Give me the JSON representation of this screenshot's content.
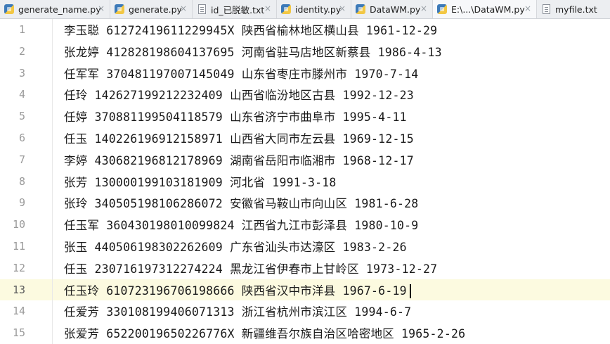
{
  "tabs": [
    {
      "label": "generate_name.py",
      "icon": "python-file-icon",
      "kind": "py",
      "close": "×"
    },
    {
      "label": "generate.py",
      "icon": "python-file-icon",
      "kind": "py",
      "close": "×"
    },
    {
      "label": "id_已脱敏.txt",
      "icon": "text-file-icon",
      "kind": "txt",
      "close": "×"
    },
    {
      "label": "identity.py",
      "icon": "python-file-icon",
      "kind": "py",
      "close": "×"
    },
    {
      "label": "DataWM.py",
      "icon": "python-file-icon",
      "kind": "py",
      "close": "×"
    },
    {
      "label": "E:\\...\\DataWM.py",
      "icon": "python-file-icon",
      "kind": "py",
      "close": "×"
    },
    {
      "label": "myfile.txt",
      "icon": "text-file-icon",
      "kind": "txt",
      "close": ""
    }
  ],
  "active_tab": 5,
  "current_line": 13,
  "lines": [
    {
      "n": "1",
      "text": "李玉聪 61272419611229945X 陕西省榆林地区横山县 1961-12-29"
    },
    {
      "n": "2",
      "text": "张龙婷 412828198604137695 河南省驻马店地区新蔡县 1986-4-13"
    },
    {
      "n": "3",
      "text": "任军军 370481197007145049 山东省枣庄市滕州市 1970-7-14"
    },
    {
      "n": "4",
      "text": "任玲 142627199212232409 山西省临汾地区古县 1992-12-23"
    },
    {
      "n": "5",
      "text": "任婷 370881199504118579 山东省济宁市曲阜市 1995-4-11"
    },
    {
      "n": "6",
      "text": "任玉 140226196912158971 山西省大同市左云县 1969-12-15"
    },
    {
      "n": "7",
      "text": "李婷 430682196812178969 湖南省岳阳市临湘市 1968-12-17"
    },
    {
      "n": "8",
      "text": "张芳 130000199103181909 河北省 1991-3-18"
    },
    {
      "n": "9",
      "text": "张玲 340505198106286072 安徽省马鞍山市向山区 1981-6-28"
    },
    {
      "n": "10",
      "text": "任玉军 360430198010099824 江西省九江市彭泽县 1980-10-9"
    },
    {
      "n": "11",
      "text": "张玉 440506198302262609 广东省汕头市达濠区 1983-2-26"
    },
    {
      "n": "12",
      "text": "任玉 230716197312274224 黑龙江省伊春市上甘岭区 1973-12-27"
    },
    {
      "n": "13",
      "text": "任玉玲 610723196706198666 陕西省汉中市洋县 1967-6-19"
    },
    {
      "n": "14",
      "text": "任爱芳 330108199406071313 浙江省杭州市滨江区 1994-6-7"
    },
    {
      "n": "15",
      "text": "张爱芳 65220019650226776X 新疆维吾尔族自治区哈密地区 1965-2-26"
    }
  ],
  "colors": {
    "current_line_bg": "#fcfae0",
    "tab_bar_bg": "#eceef1",
    "active_tab_bg": "#f7f8fa"
  }
}
